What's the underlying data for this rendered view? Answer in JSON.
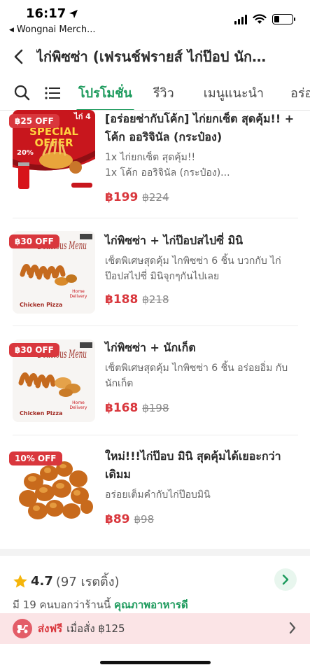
{
  "status": {
    "time": "16:17",
    "back_app": "Wongnai   Merch..."
  },
  "header": {
    "title": "ไก่พิซซ่า (เฟรนช์ฟรายส์ ไก่ป๊อป นักเก็ต)..."
  },
  "tabs": [
    {
      "label": "โปรโมชั่น",
      "active": true
    },
    {
      "label": "รีวิว",
      "active": false
    },
    {
      "label": "เมนูแนะนำ",
      "active": false
    },
    {
      "label": "อร่อย",
      "active": false
    }
  ],
  "promos": [
    {
      "badge": "฿25 OFF",
      "title": "[อร่อยซ่ากับโค้ก] ไก่ยกเซ็ต สุดคุ้ม!! + โค้ก ออริจินัล (กระป๋อง)",
      "desc": "1x ไก่ยกเซ็ต สุดคุ้ม!!\n1x โค้ก ออริจินัล (กระป๋อง)...",
      "price": "฿199",
      "old_price": "฿224",
      "image_text": {
        "line1": "SPECIAL",
        "line2": "OFFER",
        "percent": "20%",
        "corner": "ไก่ 4"
      }
    },
    {
      "badge": "฿30 OFF",
      "title": "ไก่พิซซ่า + ไก่ป๊อปสไปซี่ มินิ",
      "desc": "เซ็ตพิเศษสุดคุ้ม ไกพิซซ่า 6 ชิ้น บวกกับ ไก่ป๊อปสไปซี่ มินิจุกๆกันไปเลย",
      "price": "฿188",
      "old_price": "฿218",
      "image_text": {
        "title": "Delicious Menu",
        "caption": "Chicken Pizza"
      }
    },
    {
      "badge": "฿30 OFF",
      "title": "ไก่พิซซ่า + นักเก็ต",
      "desc": "เซ็ตพิเศษสุดคุ้ม ไกพิซซ่า 6 ชิ้น อร่อยอิ่ม กับนักเก็ต",
      "price": "฿168",
      "old_price": "฿198",
      "image_text": {
        "title": "Delicious Menu",
        "caption": "Chicken Pizza"
      }
    },
    {
      "badge": "10% OFF",
      "title": "ใหม่!!!ไก่ป๊อบ มินิ สุดคุ้มได้เยอะกว่าเดิมม",
      "desc": "อร่อยเต็มคำกับไก่ป๊อบมินิ",
      "price": "฿89",
      "old_price": "฿98"
    }
  ],
  "rating": {
    "value": "4.7",
    "count": "(97 เรตติ้ง)"
  },
  "quality": {
    "prefix": "มี 19 คนบอกว่าร้านนี้",
    "highlight": "คุณภาพอาหารดี"
  },
  "delivery": {
    "free_label": "ส่งฟรี",
    "condition": "เมื่อสั่ง ฿125"
  },
  "colors": {
    "accent_green": "#1c9a5c",
    "price_red": "#d9373d",
    "delivery_bg": "#fbe4e6"
  }
}
